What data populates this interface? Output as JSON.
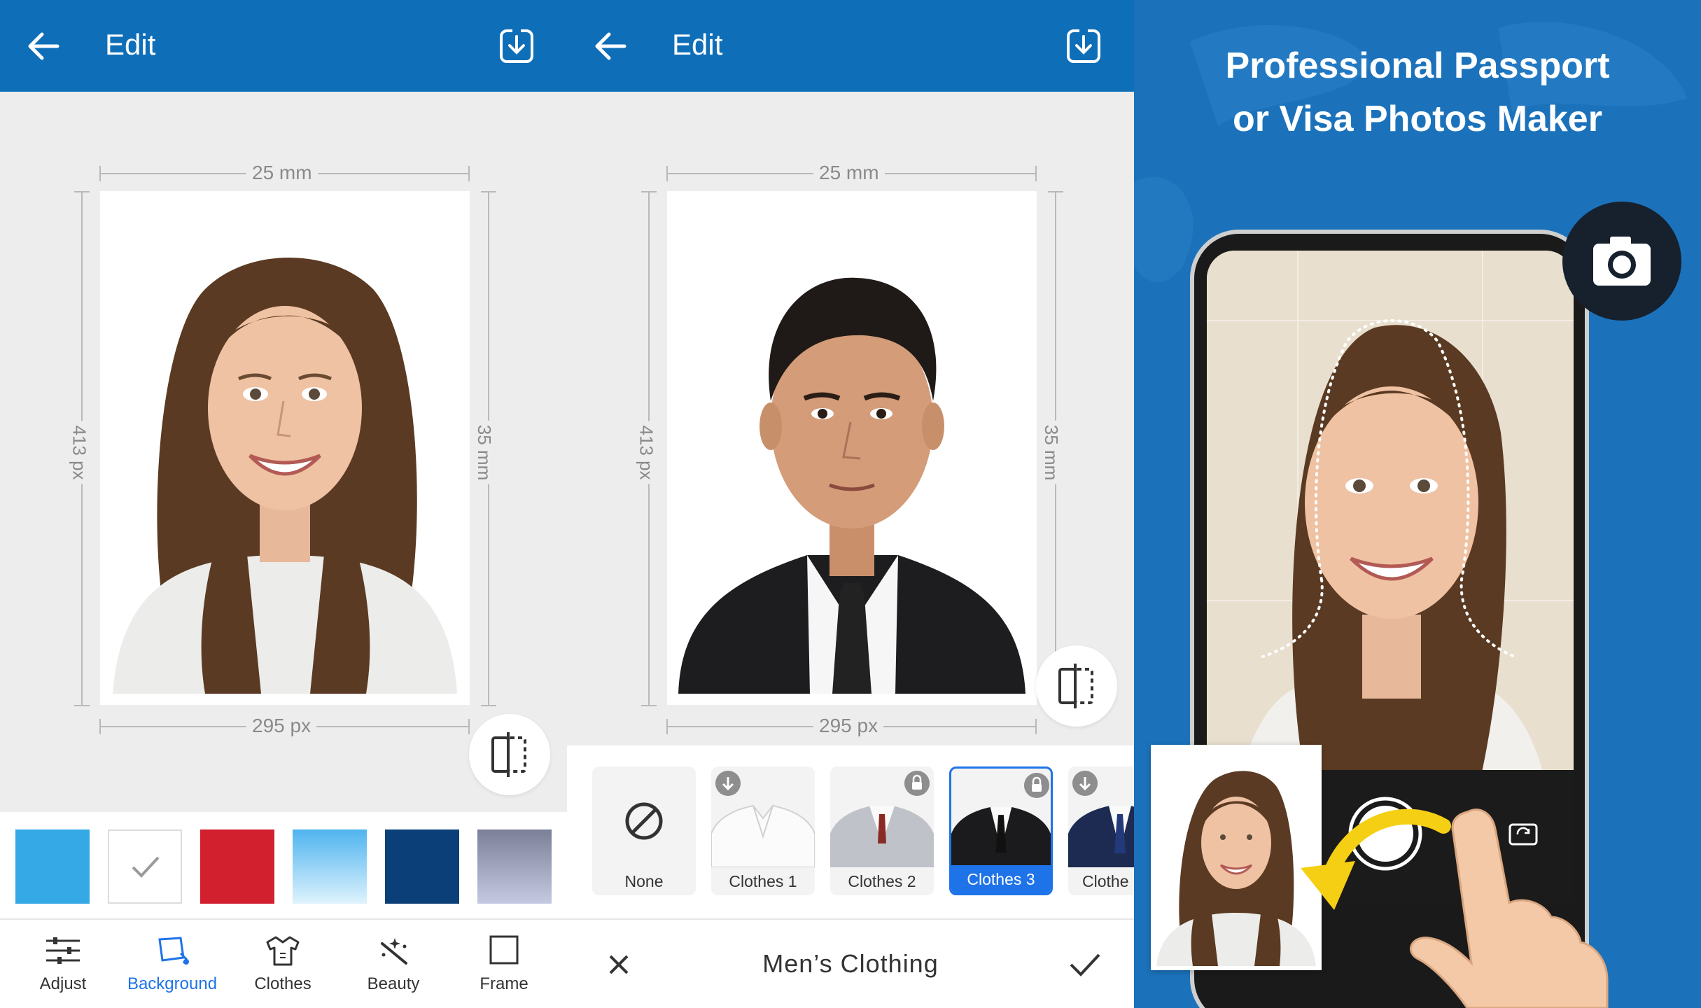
{
  "panel_background": {
    "appbar": {
      "title": "Edit",
      "back_icon": "arrow-left-icon",
      "save_icon": "download-icon"
    },
    "dims": {
      "width_mm": "25 mm",
      "width_px": "295 px",
      "height_mm": "35 mm",
      "height_px": "413 px"
    },
    "swatches": [
      {
        "name": "blue",
        "color": "#35a8e6"
      },
      {
        "name": "white",
        "color": "#ffffff",
        "selected": true
      },
      {
        "name": "red",
        "color": "#d2202f"
      },
      {
        "name": "light-blue-gradient",
        "color": "#8fd3f7"
      },
      {
        "name": "navy",
        "color": "#0b3f78"
      },
      {
        "name": "gray-gradient",
        "color": "#9ea3bd"
      }
    ],
    "nav": [
      {
        "label": "Adjust",
        "icon": "sliders-icon"
      },
      {
        "label": "Background",
        "icon": "background-icon",
        "active": true
      },
      {
        "label": "Clothes",
        "icon": "shirt-icon"
      },
      {
        "label": "Beauty",
        "icon": "magic-wand-icon"
      },
      {
        "label": "Frame",
        "icon": "frame-icon"
      }
    ]
  },
  "panel_clothes": {
    "appbar": {
      "title": "Edit",
      "back_icon": "arrow-left-icon",
      "save_icon": "download-icon"
    },
    "dims": {
      "width_mm": "25 mm",
      "width_px": "295 px",
      "height_mm": "35 mm",
      "height_px": "413 px"
    },
    "items": [
      {
        "label": "None",
        "icon": "none-icon"
      },
      {
        "label": "Clothes 1",
        "badge": "download-badge-icon"
      },
      {
        "label": "Clothes 2",
        "badge": "lock-icon"
      },
      {
        "label": "Clothes 3",
        "badge": "lock-icon",
        "selected": true
      },
      {
        "label": "Clothe",
        "badge": "download-badge-icon"
      }
    ],
    "category": "Men’s Clothing",
    "cancel_icon": "close-icon",
    "confirm_icon": "check-icon"
  },
  "panel_promo": {
    "title_line1": "Professional Passport",
    "title_line2": "or Visa Photos Maker",
    "camera_icon": "camera-icon",
    "switch_icon": "switch-camera-icon"
  },
  "colors": {
    "appbar": "#0e6eb8",
    "accent": "#1e73e8",
    "promo_bg": "#1b72bb",
    "arrow": "#f5cf14"
  }
}
